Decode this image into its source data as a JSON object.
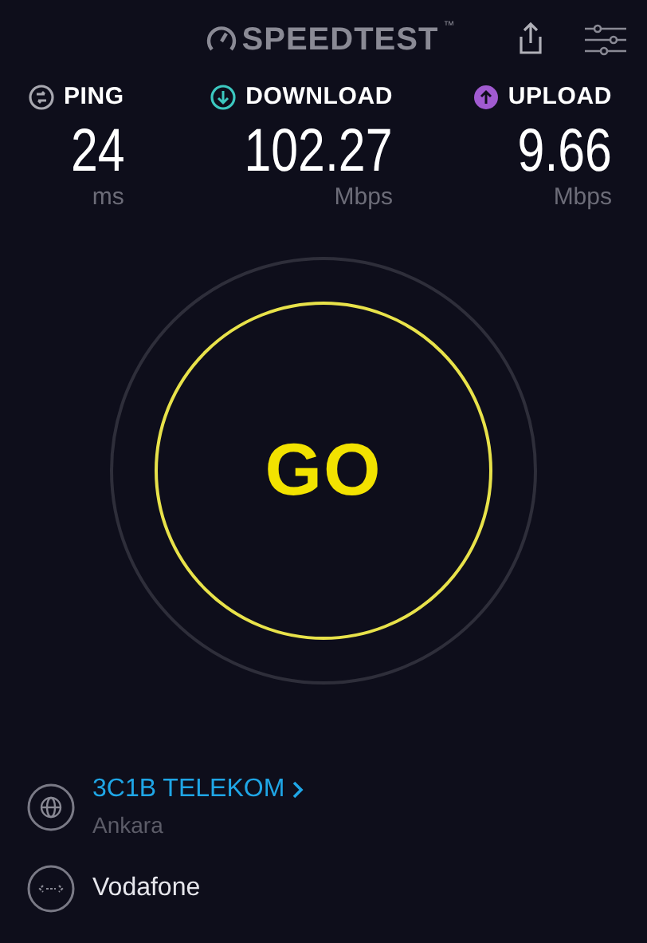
{
  "header": {
    "logo": "SPEEDTEST",
    "trademark": "™"
  },
  "metrics": [
    {
      "kind": "ping",
      "label": "PING",
      "value": "24",
      "unit": "ms",
      "color": "#a8a8b0"
    },
    {
      "kind": "download",
      "label": "DOWNLOAD",
      "value": "102.27",
      "unit": "Mbps",
      "color": "#3cc8c0"
    },
    {
      "kind": "upload",
      "label": "UPLOAD",
      "value": "9.66",
      "unit": "Mbps",
      "color": "#a05ad0"
    }
  ],
  "go_button": {
    "label": "GO"
  },
  "server": {
    "provider": "3C1B TELEKOM",
    "location": "Ankara"
  },
  "connection": {
    "provider": "Vodafone"
  }
}
